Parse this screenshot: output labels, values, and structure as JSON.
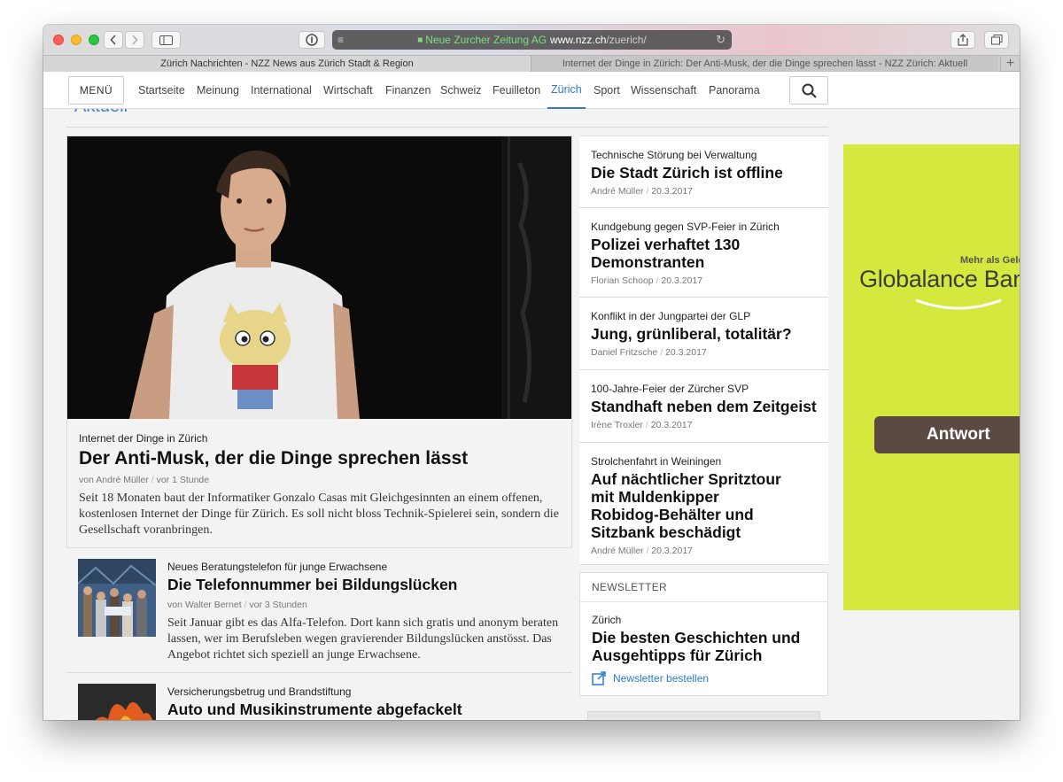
{
  "browser": {
    "address": {
      "ev_name": "Neue Zurcher Zeitung AG",
      "host": "www.nzz.ch",
      "path": "/zuerich/"
    },
    "tabs": [
      {
        "label": "Zürich Nachrichten - NZZ News aus Zürich Stadt & Region"
      },
      {
        "label": "Internet der Dinge in Zürich: Der Anti-Musk, der die Dinge sprechen lässt - NZZ Zürich: Aktuell"
      }
    ],
    "new_tab": "+"
  },
  "nav": {
    "menu_label": "MENÜ",
    "items": [
      {
        "label": "Startseite"
      },
      {
        "label": "Meinung"
      },
      {
        "label": "International"
      },
      {
        "label": "Wirtschaft"
      },
      {
        "label": "Finanzen"
      },
      {
        "label": "Schweiz"
      },
      {
        "label": "Feuilleton"
      },
      {
        "label": "Zürich"
      },
      {
        "label": "Sport"
      },
      {
        "label": "Wissenschaft"
      },
      {
        "label": "Panorama"
      }
    ],
    "active_index": 7
  },
  "section_title": "Aktuell",
  "lead": {
    "kicker": "Internet der Dinge in Zürich",
    "headline": "Der Anti-Musk, der die Dinge sprechen lässt",
    "author": "von André Müller",
    "time": "vor 1 Stunde",
    "lede": "Seit 18 Monaten baut der Informatiker Gonzalo Casas mit Gleichgesinnten an einem offenen, kostenlosen Internet der Dinge für Zürich. Es soll nicht bloss Technik-Spielerei sein, sondern die Gesellschaft voranbringen."
  },
  "sub_articles": [
    {
      "kicker": "Neues Beratungstelefon für junge Erwachsene",
      "headline": "Die Telefonnummer bei Bildungslücken",
      "author": "von Walter Bernet",
      "time": "vor 3 Stunden",
      "lede": "Seit Januar gibt es das Alfa-Telefon. Dort kann sich gratis und anonym beraten lassen, wer im Berufsleben wegen gravierender Bildungslücken anstösst. Das Angebot richtet sich speziell an junge Erwachsene."
    },
    {
      "kicker": "Versicherungsbetrug und Brandstiftung",
      "headline": "Auto und Musikinstrumente abgefackelt"
    }
  ],
  "right_articles": [
    {
      "kicker": "Technische Störung bei Verwaltung",
      "headline": "Die Stadt Zürich ist offline",
      "author": "André Müller",
      "date": "20.3.2017"
    },
    {
      "kicker": "Kundgebung gegen SVP-Feier in Zürich",
      "headline": "Polizei verhaftet 130 Demonstranten",
      "author": "Florian Schoop",
      "date": "20.3.2017"
    },
    {
      "kicker": "Konflikt in der Jungpartei der GLP",
      "headline": "Jung, grünliberal, totalitär?",
      "author": "Daniel Fritzsche",
      "date": "20.3.2017"
    },
    {
      "kicker": "100-Jahre-Feier der Zürcher SVP",
      "headline": "Standhaft neben dem Zeitgeist",
      "author": "Irène Troxler",
      "date": "20.3.2017"
    },
    {
      "kicker": "Strolchenfahrt in Weiningen",
      "headline": "Auf nächtlicher Spritztour mit Muldenkipper Robidog-Behälter und Sitzbank beschädigt",
      "author": "André Müller",
      "date": "20.3.2017"
    }
  ],
  "newsletter": {
    "title": "NEWSLETTER",
    "kicker": "Zürich",
    "headline": "Die besten Geschichten und Ausgehtipps für Zürich",
    "link": "Newsletter bestellen"
  },
  "ad": {
    "small": "Mehr als Geld",
    "brand": "Globalance Bank",
    "button": "Antwort"
  },
  "colors": {
    "accent": "#2b7bd0",
    "ad_background": "#d4e83e",
    "ad_button": "#5a4a42"
  }
}
